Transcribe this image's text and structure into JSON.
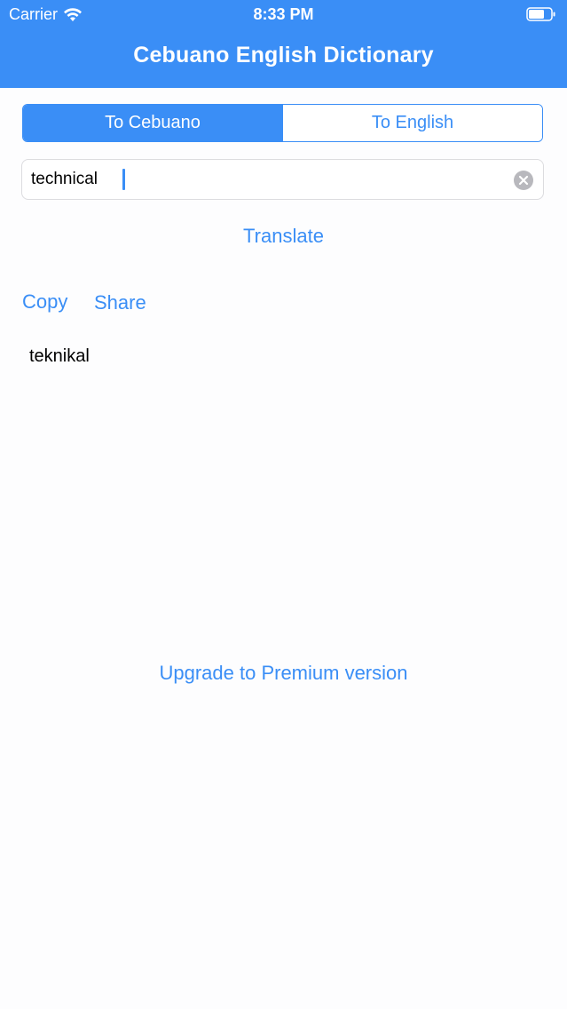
{
  "status_bar": {
    "carrier": "Carrier",
    "time": "8:33 PM",
    "icons": [
      "wifi-icon",
      "battery-icon"
    ]
  },
  "nav": {
    "title": "Cebuano English Dictionary"
  },
  "segmented": {
    "options": [
      "To Cebuano",
      "To English"
    ],
    "selected": "To Cebuano"
  },
  "search": {
    "value": "technical",
    "clear_icon": "clear-circle-icon"
  },
  "actions": {
    "translate": "Translate",
    "copy": "Copy",
    "share": "Share",
    "upgrade": "Upgrade to Premium version"
  },
  "result": {
    "text": "teknikal"
  },
  "colors": {
    "accent": "#3a8ef6",
    "background": "#fdfdfe",
    "text": "#000000"
  }
}
